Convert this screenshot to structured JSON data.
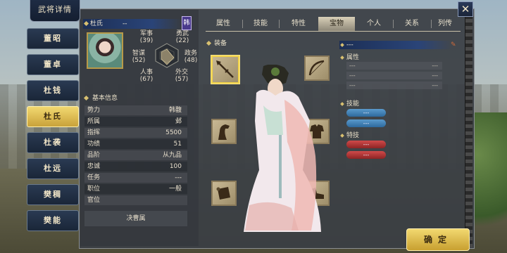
{
  "window_title": "武将详情",
  "close_glyph": "✕",
  "side_tabs": [
    "董昭",
    "董卓",
    "杜钱",
    "杜氏",
    "杜袭",
    "杜远",
    "樊稠",
    "樊能"
  ],
  "side_active_index": 3,
  "general": {
    "name": "杜氏",
    "name_dash": "--",
    "clan_badge": "韩",
    "stats": {
      "military": {
        "label": "军事",
        "value": "(39)"
      },
      "bravery": {
        "label": "勇武",
        "value": "(22)"
      },
      "strategy": {
        "label": "智谋",
        "value": "(52)"
      },
      "politics": {
        "label": "政务",
        "value": "(48)"
      },
      "personnel": {
        "label": "人事",
        "value": "(67)"
      },
      "diplomacy": {
        "label": "外交",
        "value": "(57)"
      }
    }
  },
  "basic_info": {
    "heading": "基本信息",
    "rows": [
      {
        "k": "势力",
        "v": "韩馥"
      },
      {
        "k": "所属",
        "v": "邺"
      },
      {
        "k": "指挥",
        "v": "5500"
      },
      {
        "k": "功绩",
        "v": "51"
      },
      {
        "k": "品阶",
        "v": "从九品"
      },
      {
        "k": "忠诚",
        "v": "100"
      },
      {
        "k": "任务",
        "v": "---"
      },
      {
        "k": "职位",
        "v": "一般"
      },
      {
        "k": "官位",
        "v": ""
      }
    ],
    "bottom_button": "决曹属"
  },
  "tabs": [
    "属性",
    "技能",
    "特性",
    "宝物",
    "个人",
    "关系",
    "列传"
  ],
  "tab_active_index": 3,
  "equipment": {
    "heading": "装备",
    "slots": [
      {
        "icon": "spear-icon",
        "selected": true
      },
      {
        "icon": "bow-icon",
        "selected": false
      },
      {
        "icon": "horse-icon",
        "selected": false
      },
      {
        "icon": "armor-icon",
        "selected": false
      },
      {
        "icon": "scroll-icon",
        "selected": false
      },
      {
        "icon": "boots-icon",
        "selected": false
      }
    ]
  },
  "detail": {
    "title": "---",
    "attributes_heading": "属性",
    "attributes": [
      {
        "a": "---",
        "b": "---"
      },
      {
        "a": "---",
        "b": "---"
      },
      {
        "a": "---",
        "b": "---"
      }
    ],
    "skills_heading": "技能",
    "skills": [
      "---",
      "---"
    ],
    "specials_heading": "特技",
    "specials": [
      "---",
      "---"
    ]
  },
  "confirm_label": "确定",
  "colors": {
    "accent_gold": "#f2d870",
    "panel_blue": "#1c2f56",
    "skill_blue": "#5a9acc",
    "special_red": "#d04a4a"
  }
}
